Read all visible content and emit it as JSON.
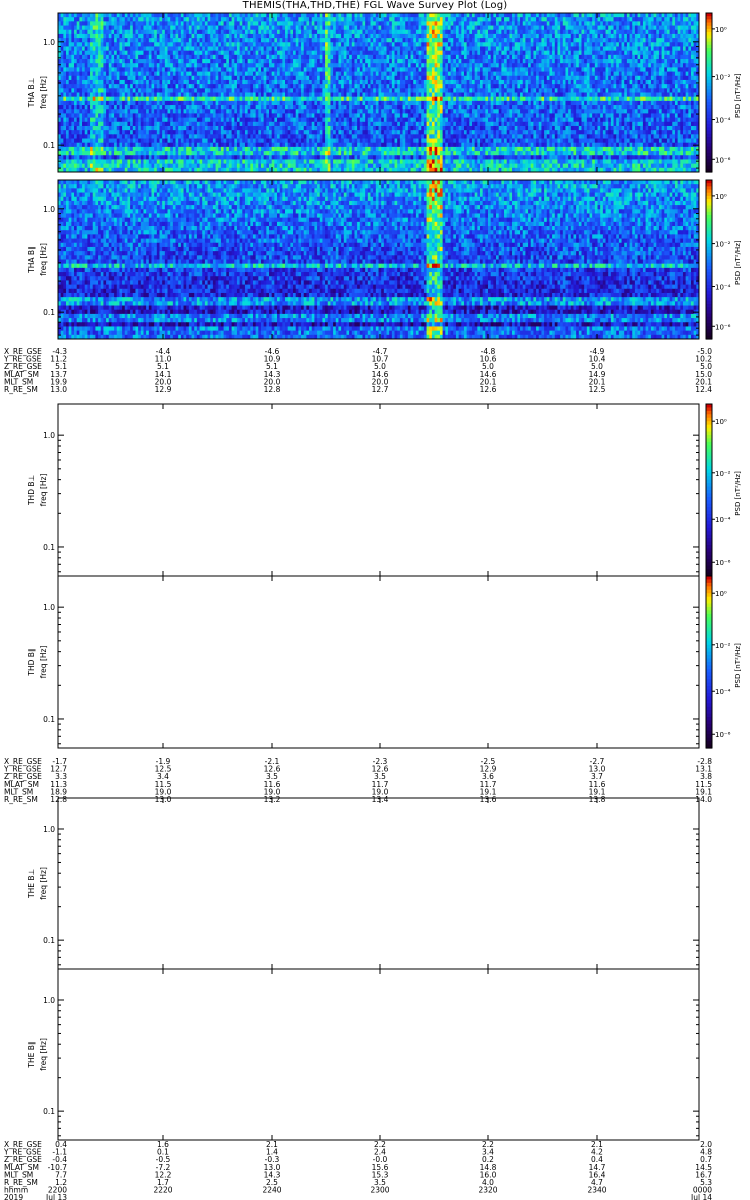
{
  "title": "THEMIS(THA,THD,THE) FGL Wave Survey Plot (Log)",
  "yticks": [
    "1.0",
    "0.1"
  ],
  "cbar_label": "PSD [nT²/Hz]",
  "cbar_ticks": [
    "10⁰",
    "10⁻²",
    "10⁻⁴",
    "10⁻⁶"
  ],
  "chart_data": [
    {
      "type": "heatmap",
      "probe": "THA",
      "panels": [
        {
          "label": "THA B⊥",
          "ylabel": "freq [Hz]",
          "has_data": true
        },
        {
          "label": "THA B∥",
          "ylabel": "freq [Hz]",
          "has_data": true
        }
      ],
      "ephemeris": [
        {
          "name": "X_RE_GSE",
          "values": [
            "-4.3",
            "-4.4",
            "-4.6",
            "-4.7",
            "-4.8",
            "-4.9",
            "-5.0"
          ]
        },
        {
          "name": "Y_RE_GSE",
          "values": [
            "11.2",
            "11.0",
            "10.9",
            "10.7",
            "10.6",
            "10.4",
            "10.2"
          ]
        },
        {
          "name": "Z_RE_GSE",
          "values": [
            "5.1",
            "5.1",
            "5.1",
            "5.0",
            "5.0",
            "5.0",
            "5.0"
          ]
        },
        {
          "name": "MLAT_SM",
          "values": [
            "13.7",
            "14.1",
            "14.3",
            "14.6",
            "14.6",
            "14.9",
            "15.0"
          ]
        },
        {
          "name": "MLT_SM",
          "values": [
            "19.9",
            "20.0",
            "20.0",
            "20.0",
            "20.1",
            "20.1",
            "20.1"
          ]
        },
        {
          "name": "R_RE_SM",
          "values": [
            "13.0",
            "12.9",
            "12.8",
            "12.7",
            "12.6",
            "12.5",
            "12.4"
          ]
        }
      ]
    },
    {
      "type": "heatmap",
      "probe": "THD",
      "panels": [
        {
          "label": "THD B⊥",
          "ylabel": "freq [Hz]",
          "has_data": false
        },
        {
          "label": "THD B∥",
          "ylabel": "freq [Hz]",
          "has_data": false
        }
      ],
      "ephemeris": [
        {
          "name": "X_RE_GSE",
          "values": [
            "-1.7",
            "-1.9",
            "-2.1",
            "-2.3",
            "-2.5",
            "-2.7",
            "-2.8"
          ]
        },
        {
          "name": "Y_RE_GSE",
          "values": [
            "12.7",
            "12.5",
            "12.6",
            "12.6",
            "12.9",
            "13.0",
            "13.1"
          ]
        },
        {
          "name": "Z_RE_GSE",
          "values": [
            "3.3",
            "3.4",
            "3.5",
            "3.5",
            "3.6",
            "3.7",
            "3.8"
          ]
        },
        {
          "name": "MLAT_SM",
          "values": [
            "11.3",
            "11.5",
            "11.6",
            "11.7",
            "11.7",
            "11.6",
            "11.5"
          ]
        },
        {
          "name": "MLT_SM",
          "values": [
            "18.9",
            "19.0",
            "19.0",
            "19.0",
            "19.1",
            "19.1",
            "19.1"
          ]
        },
        {
          "name": "R_RE_SM",
          "values": [
            "12.8",
            "13.0",
            "13.2",
            "13.4",
            "13.6",
            "13.8",
            "14.0"
          ]
        }
      ]
    },
    {
      "type": "heatmap",
      "probe": "THE",
      "panels": [
        {
          "label": "THE B⊥",
          "ylabel": "freq [Hz]",
          "has_data": false
        },
        {
          "label": "THE B∥",
          "ylabel": "freq [Hz]",
          "has_data": false
        }
      ],
      "ephemeris": [
        {
          "name": "X_RE_GSE",
          "values": [
            "0.4",
            "1.6",
            "2.1",
            "2.2",
            "2.2",
            "2.1",
            "2.0"
          ]
        },
        {
          "name": "Y_RE_GSE",
          "values": [
            "-1.1",
            "0.1",
            "1.4",
            "2.4",
            "3.4",
            "4.2",
            "4.8"
          ]
        },
        {
          "name": "Z_RE_GSE",
          "values": [
            "-0.4",
            "-0.5",
            "-0.3",
            "-0.0",
            "0.2",
            "0.4",
            "0.7"
          ]
        },
        {
          "name": "MLAT_SM",
          "values": [
            "-10.7",
            "-7.2",
            "13.0",
            "15.6",
            "14.8",
            "14.7",
            "14.5"
          ]
        },
        {
          "name": "MLT_SM",
          "values": [
            "7.7",
            "12.2",
            "14.3",
            "15.3",
            "16.0",
            "16.4",
            "16.7"
          ]
        },
        {
          "name": "R_RE_SM",
          "values": [
            "1.2",
            "1.7",
            "2.5",
            "3.5",
            "4.0",
            "4.7",
            "5.3"
          ]
        }
      ],
      "time_rows": [
        {
          "name": "hhmm",
          "values": [
            "2200",
            "2220",
            "2240",
            "2300",
            "2320",
            "2340",
            "0000"
          ]
        },
        {
          "name": "2019",
          "values": [
            "Jul 13",
            "",
            "",
            "",
            "",
            "",
            "Jul 14"
          ]
        }
      ]
    }
  ]
}
